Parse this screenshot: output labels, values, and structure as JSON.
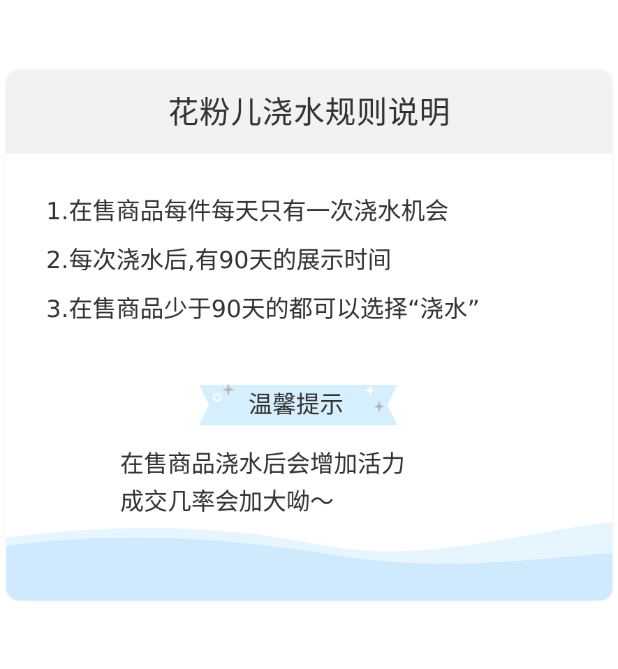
{
  "title": "花粉儿浇水规则说明",
  "rules": [
    "1.在售商品每件每天只有一次浇水机会",
    "2.每次浇水后,有90天的展示时间",
    "3.在售商品少于90天的都可以选择“浇水”"
  ],
  "tip": {
    "label": "温馨提示",
    "lines": [
      "在售商品浇水后会增加活力",
      "成交几率会加大呦～"
    ]
  },
  "colors": {
    "header_bg": "#f2f2f2",
    "banner_blue": "#d6efff",
    "wave_light": "#e6f5ff",
    "wave_mid": "#cfeafd",
    "sparkle": "#b8b8b8",
    "text": "#333333"
  },
  "icons": [
    "sparkle-icon",
    "circle-icon",
    "wave-decoration"
  ]
}
